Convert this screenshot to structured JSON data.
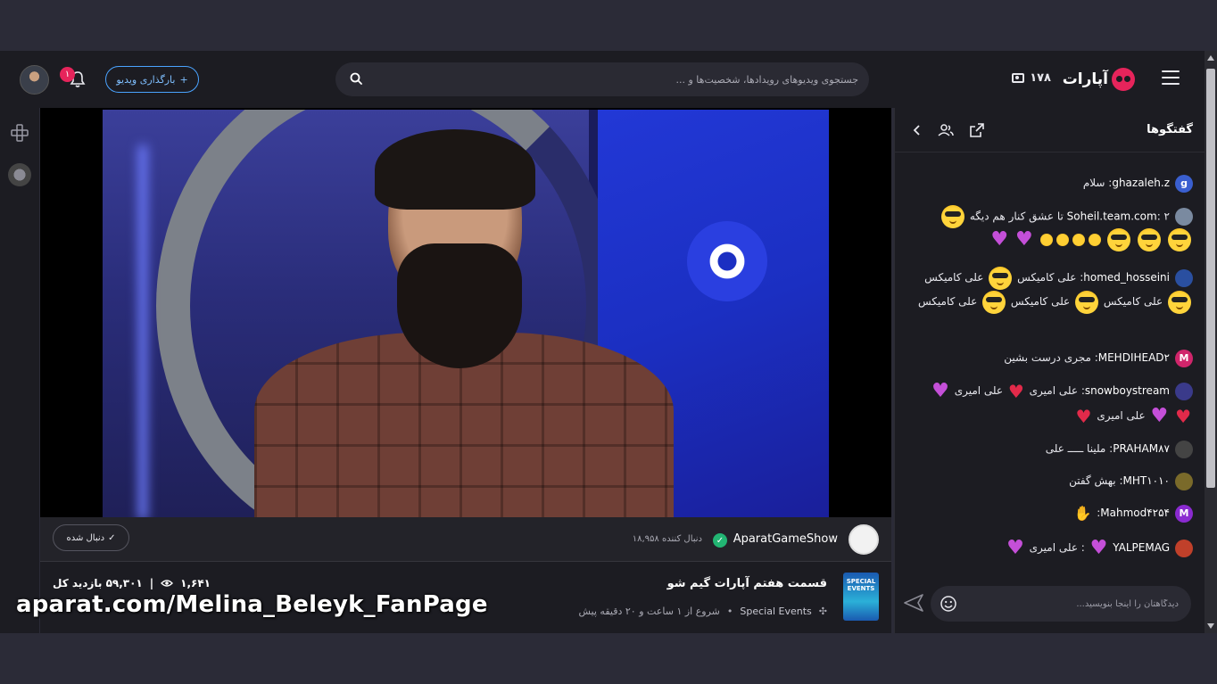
{
  "header": {
    "logo_text": "آپارات",
    "live_viewers": "۱۷۸",
    "search_placeholder": "جستجوی ویدیوهای رویدادها، شخصیت‌ها و ...",
    "upload_label": "بارگذاری ویدیو",
    "notification_count": "۱"
  },
  "player": {
    "channel_name": "AparatGameShow",
    "followers": "۱۸,۹۵۸ دنبال کننده",
    "follow_state_label": "دنبال شده",
    "title": "قسمت هفتم آپارات گیم شو",
    "category": "Special Events",
    "started": "شروع از ۱ ساعت و ۲۰ دقیقه پیش",
    "current_viewers": "۱,۶۴۱",
    "total_views": "۵۹,۳۰۱ بازدید کل",
    "thumb_text": "SPECIAL EVENTS"
  },
  "watermark": "aparat.com/Melina_Beleyk_FanPage",
  "chat": {
    "title": "گفتگوها",
    "input_placeholder": "دیدگاهتان را اینجا بنویسید...",
    "messages": [
      {
        "user": "ghazaleh.z",
        "text": ": سلام",
        "avatar_letter": "g",
        "avatar_color": "#3a5fd0"
      },
      {
        "user": "Soheil.team.com",
        "text": ": ۲ تا عشق کنار هم دیگه",
        "avatar_letter": "",
        "avatar_color": "#7a8aa0"
      },
      {
        "user": "homed_hosseini",
        "text": ": علی کامیکس",
        "text2": "علی کامیکس",
        "text3": "علی کامیکس",
        "text4": "علی کامیکس",
        "text5": "علی کامیکس",
        "avatar_letter": "",
        "avatar_color": "#2a4fa0"
      },
      {
        "user": "MEHDIHEAD۲",
        "text": ": مجری درست بشین",
        "avatar_letter": "M",
        "avatar_color": "#d0256b"
      },
      {
        "user": "snowboystream",
        "text": ": علی امیری",
        "text2": "علی امیری",
        "text3": "علی امیری",
        "avatar_letter": "",
        "avatar_color": "#3a3a8a"
      },
      {
        "user": "PRAHAM۸۷",
        "text": ": ملینا ـــــ علی",
        "avatar_letter": "",
        "avatar_color": "#444"
      },
      {
        "user": "MHT۱۰۱۰",
        "text": ": بهش گفتن",
        "avatar_letter": "",
        "avatar_color": "#7a6a2a"
      },
      {
        "user": "Mahmod۴۲۵۴",
        "text": ":",
        "avatar_letter": "M",
        "avatar_color": "#8a2ad0"
      },
      {
        "user": "YALPEMAG",
        "text": ": علی امیری",
        "avatar_letter": "",
        "avatar_color": "#c0402a"
      }
    ]
  }
}
